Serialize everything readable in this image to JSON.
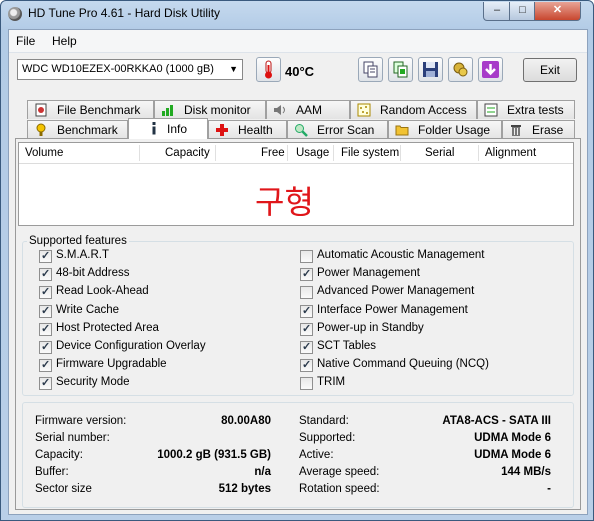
{
  "window": {
    "title": "HD Tune Pro 4.61 - Hard Disk Utility",
    "min_glyph": "–",
    "max_glyph": "□",
    "close_glyph": "✕"
  },
  "menu": {
    "items": [
      "File",
      "Help"
    ]
  },
  "toolbar": {
    "drive": "WDC WD10EZEX-00RKKA0    (1000 gB)",
    "temperature": "40°C",
    "exit_label": "Exit",
    "icons": [
      "copy-text-icon",
      "copy-info-icon",
      "save-icon",
      "options-icon",
      "download-icon"
    ]
  },
  "tabs": {
    "row1": [
      {
        "label": "File Benchmark",
        "icon": "file-benchmark-icon"
      },
      {
        "label": "Disk monitor",
        "icon": "disk-monitor-icon"
      },
      {
        "label": "AAM",
        "icon": "speaker-icon"
      },
      {
        "label": "Random Access",
        "icon": "random-access-icon"
      },
      {
        "label": "Extra tests",
        "icon": "extra-tests-icon"
      }
    ],
    "row2": [
      {
        "label": "Benchmark",
        "icon": "benchmark-icon"
      },
      {
        "label": "Info",
        "icon": "info-icon"
      },
      {
        "label": "Health",
        "icon": "health-icon"
      },
      {
        "label": "Error Scan",
        "icon": "error-scan-icon"
      },
      {
        "label": "Folder Usage",
        "icon": "folder-icon"
      },
      {
        "label": "Erase",
        "icon": "erase-icon"
      }
    ],
    "active": "Info"
  },
  "volumes": {
    "columns": [
      "Volume",
      "Capacity",
      "Free",
      "Usage",
      "File system",
      "Serial",
      "Alignment"
    ],
    "overlay_text": "구형"
  },
  "features": {
    "label": "Supported features",
    "left": [
      {
        "name": "S.M.A.R.T",
        "checked": true
      },
      {
        "name": "48-bit Address",
        "checked": true
      },
      {
        "name": "Read Look-Ahead",
        "checked": true
      },
      {
        "name": "Write Cache",
        "checked": true
      },
      {
        "name": "Host Protected Area",
        "checked": true
      },
      {
        "name": "Device Configuration Overlay",
        "checked": true
      },
      {
        "name": "Firmware Upgradable",
        "checked": true
      },
      {
        "name": "Security Mode",
        "checked": true
      }
    ],
    "right": [
      {
        "name": "Automatic Acoustic Management",
        "checked": false
      },
      {
        "name": "Power Management",
        "checked": true
      },
      {
        "name": "Advanced Power Management",
        "checked": false
      },
      {
        "name": "Interface Power Management",
        "checked": true
      },
      {
        "name": "Power-up in Standby",
        "checked": true
      },
      {
        "name": "SCT Tables",
        "checked": true
      },
      {
        "name": "Native Command Queuing (NCQ)",
        "checked": true
      },
      {
        "name": "TRIM",
        "checked": false
      }
    ]
  },
  "info": {
    "left": [
      {
        "label": "Firmware version:",
        "value": "80.00A80"
      },
      {
        "label": "Serial number:",
        "value": ""
      },
      {
        "label": "Capacity:",
        "value": "1000.2 gB (931.5 GB)"
      },
      {
        "label": "Buffer:",
        "value": "n/a"
      },
      {
        "label": "Sector size",
        "value": "512 bytes"
      }
    ],
    "right": [
      {
        "label": "Standard:",
        "value": "ATA8-ACS - SATA III"
      },
      {
        "label": "Supported:",
        "value": "UDMA Mode 6"
      },
      {
        "label": "Active:",
        "value": "UDMA Mode 6"
      },
      {
        "label": "Average speed:",
        "value": "144 MB/s"
      },
      {
        "label": "Rotation speed:",
        "value": "-"
      }
    ]
  }
}
